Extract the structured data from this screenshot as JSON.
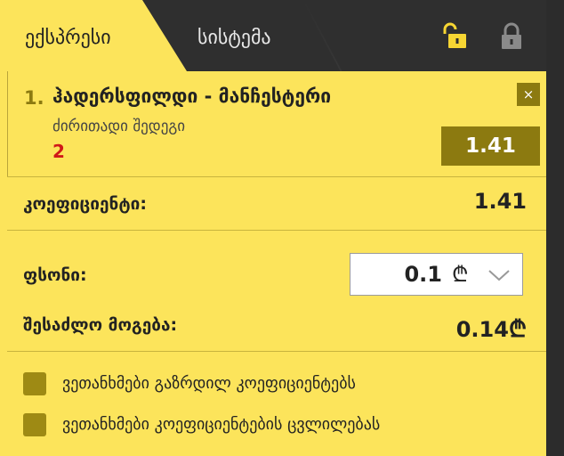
{
  "tabs": {
    "express": "ექსპრესი",
    "system": "სისტემა"
  },
  "icons": {
    "unlock": "unlock-icon",
    "lock": "lock-icon",
    "close": "close-icon",
    "currency": "lari-icon",
    "chevron": "chevron-down-icon"
  },
  "bet": {
    "index": "1.",
    "match": "ჰადერსფილდი - მანჩესტერი",
    "market": "ძირითადი შედეგი",
    "outcome": "2",
    "odd": "1.41",
    "close_label": "×"
  },
  "summary": {
    "coef_label": "კოეფიციენტი:",
    "coef_value": "1.41",
    "stake_label": "ფსონი:",
    "stake_value": "0.1",
    "currency_symbol": "₾",
    "win_label": "შესაძლო მოგება:",
    "win_value": "0.14"
  },
  "options": [
    {
      "label": "ვეთანხმები გაზრდილ კოეფიციენტებს"
    },
    {
      "label": "ვეთანხმები კოეფიციენტების ცვლილებას"
    }
  ],
  "colors": {
    "panel": "#fce45b",
    "dark": "#2f2f2f",
    "accent": "#8c7a10",
    "outcome": "#d01818"
  }
}
